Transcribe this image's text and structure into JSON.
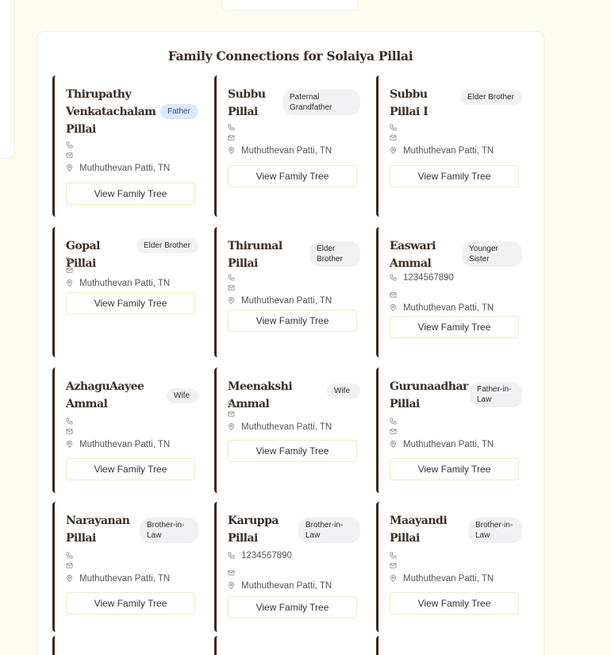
{
  "panel": {
    "title": "Family Connections for Solaiya Pillai"
  },
  "button_label": "View Family Tree",
  "location": "Muthuthevan Patti, TN",
  "members": [
    {
      "name": "Thirupathy Venkatachalam Pillai",
      "relation": "Father",
      "phone": ""
    },
    {
      "name": "Subbu Pillai",
      "relation": "Paternal Grandfather",
      "phone": ""
    },
    {
      "name": "Subbu Pillai I",
      "relation": "Elder Brother",
      "phone": ""
    },
    {
      "name": "Gopal Pillai",
      "relation": "Elder Brother",
      "phone": ""
    },
    {
      "name": "Thirumal Pillai",
      "relation": "Elder Brother",
      "phone": ""
    },
    {
      "name": "Easwari Ammal",
      "relation": "Younger Sister",
      "phone": "1234567890"
    },
    {
      "name": "AzhaguAayee Ammal",
      "relation": "Wife",
      "phone": ""
    },
    {
      "name": "Meenakshi Ammal",
      "relation": "Wife",
      "phone": ""
    },
    {
      "name": "Gurunaadhar Pillai",
      "relation": "Father-in-Law",
      "phone": ""
    },
    {
      "name": "Narayanan Pillai",
      "relation": "Brother-in-Law",
      "phone": ""
    },
    {
      "name": "Karuppa Pillai",
      "relation": "Brother-in-Law",
      "phone": "1234567890"
    },
    {
      "name": "Maayandi Pillai",
      "relation": "Brother-in-Law",
      "phone": ""
    }
  ],
  "colors": {
    "background": "#fdfcf0",
    "card_accent": "#3a2a1d",
    "father_badge": "#dde8fb"
  }
}
